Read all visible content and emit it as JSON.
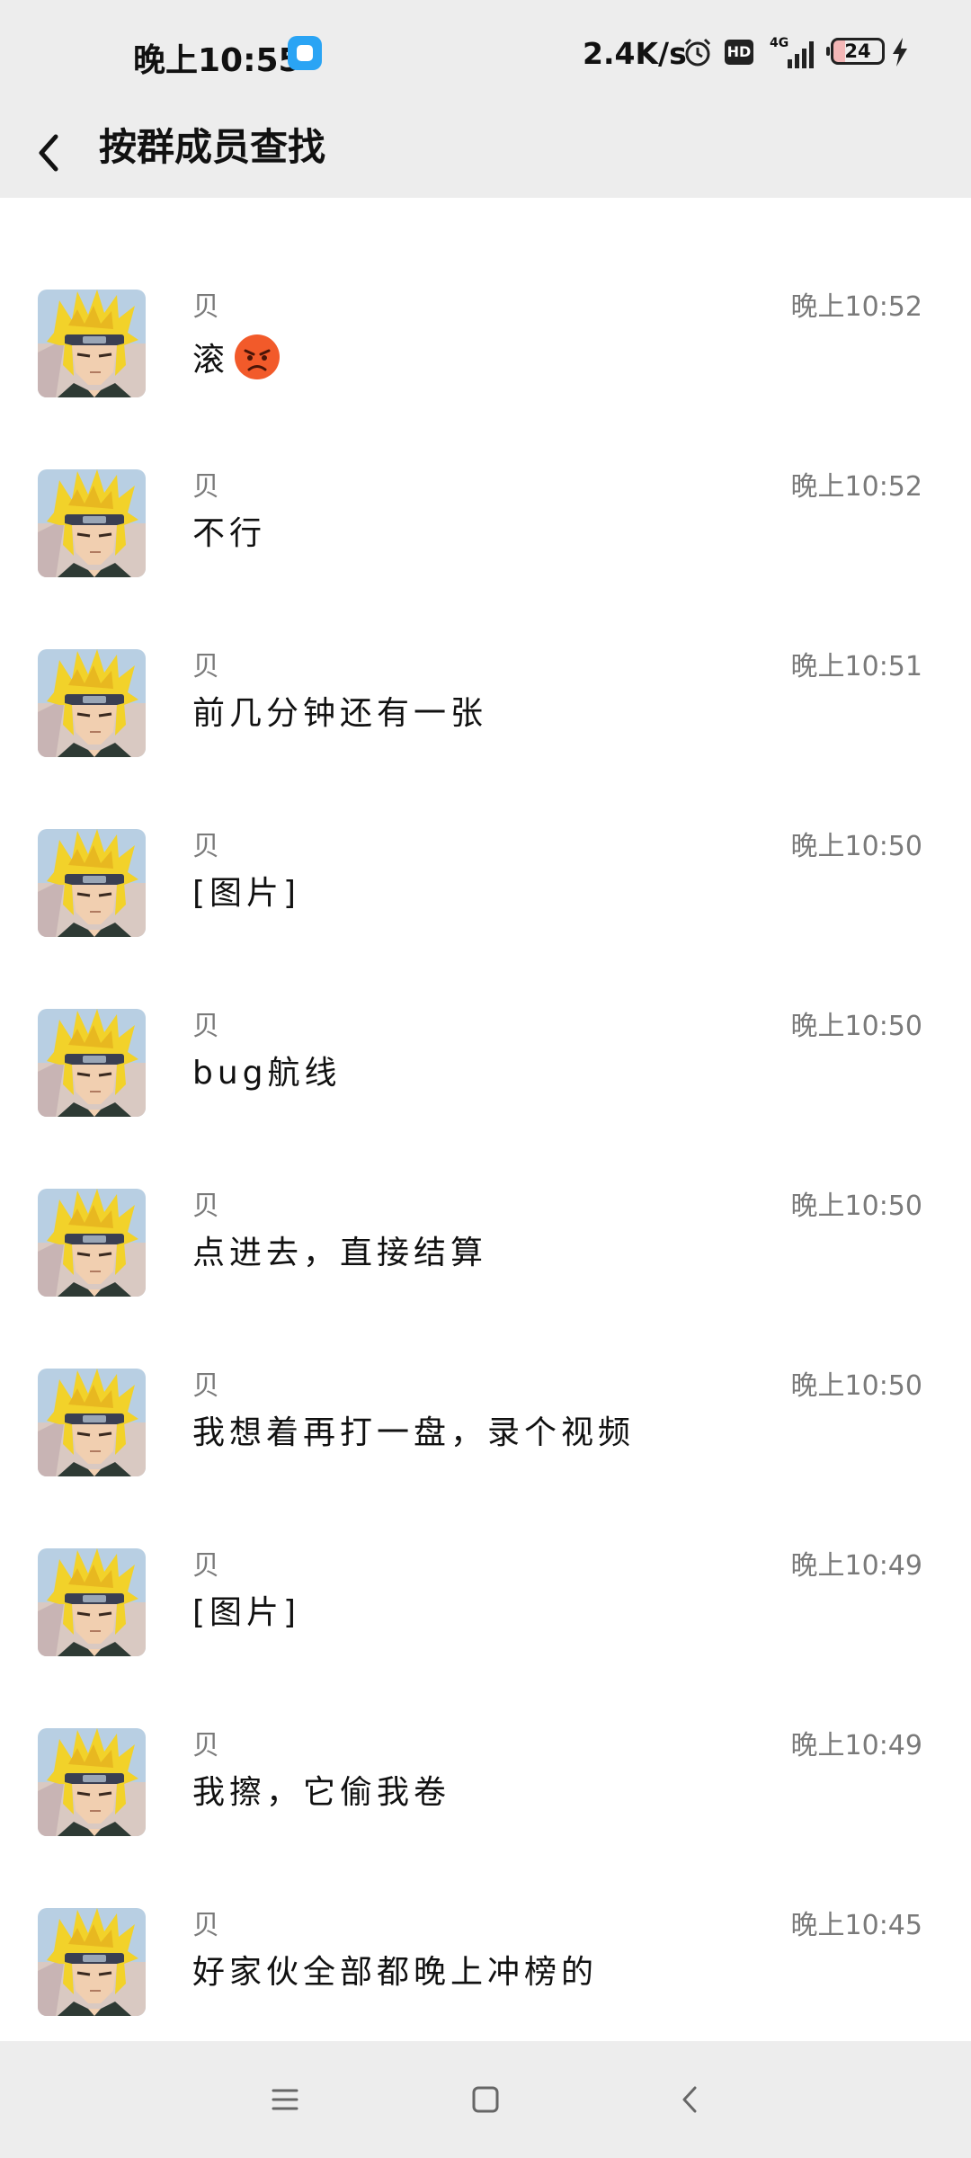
{
  "status_bar": {
    "time": "晚上10:55",
    "network_speed": "2.4K/s",
    "hd_badge": "HD",
    "network_type": "4G",
    "battery_level": "24"
  },
  "header": {
    "title": "按群成员查找"
  },
  "messages": [
    {
      "sender": "贝",
      "text": "滚",
      "emoji": "angry-face-emoji",
      "time": "晚上10:52"
    },
    {
      "sender": "贝",
      "text": "不行",
      "time": "晚上10:52"
    },
    {
      "sender": "贝",
      "text": "前几分钟还有一张",
      "time": "晚上10:51"
    },
    {
      "sender": "贝",
      "text": "[图片]",
      "time": "晚上10:50"
    },
    {
      "sender": "贝",
      "text": "bug航线",
      "time": "晚上10:50"
    },
    {
      "sender": "贝",
      "text": "点进去，直接结算",
      "time": "晚上10:50"
    },
    {
      "sender": "贝",
      "text": "我想着再打一盘，录个视频",
      "time": "晚上10:50"
    },
    {
      "sender": "贝",
      "text": "[图片]",
      "time": "晚上10:49"
    },
    {
      "sender": "贝",
      "text": "我擦，它偷我卷",
      "time": "晚上10:49"
    },
    {
      "sender": "贝",
      "text": "好家伙全部都晚上冲榜的",
      "time": "晚上10:45"
    }
  ],
  "icons": {
    "back": "chevron-left-icon",
    "nav_menu": "menu-icon",
    "nav_home": "home-square-icon",
    "nav_back": "back-chevron-icon"
  },
  "colors": {
    "header_background": "#ededed",
    "list_background": "#ffffff",
    "secondary_text": "#7a7a7a",
    "primary_text": "#111111"
  }
}
